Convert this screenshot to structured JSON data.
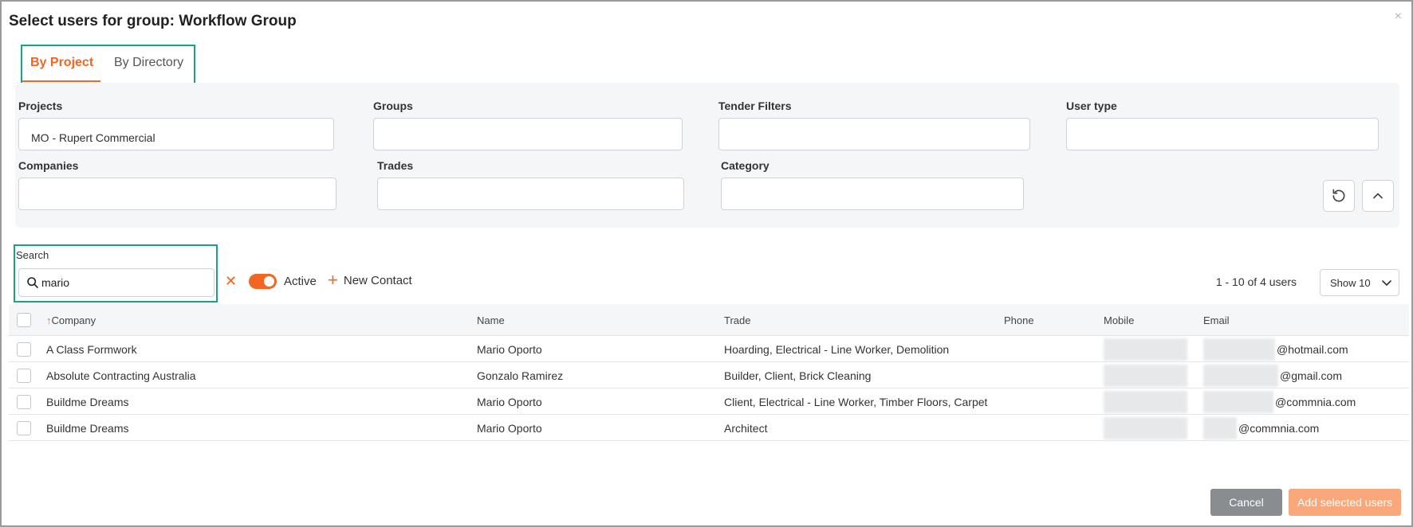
{
  "dialog": {
    "title": "Select users for group: Workflow Group",
    "close_glyph": "×"
  },
  "tabs": [
    {
      "label": "By Project",
      "active": true
    },
    {
      "label": "By Directory",
      "active": false
    }
  ],
  "filters": {
    "projects": {
      "label": "Projects",
      "value": "MO - Rupert Commercial"
    },
    "groups": {
      "label": "Groups",
      "value": ""
    },
    "tender_filters": {
      "label": "Tender Filters",
      "value": ""
    },
    "user_type": {
      "label": "User type",
      "value": ""
    },
    "companies": {
      "label": "Companies",
      "value": ""
    },
    "trades": {
      "label": "Trades",
      "value": ""
    },
    "category": {
      "label": "Category",
      "value": ""
    },
    "reset_icon": "refresh-icon",
    "collapse_icon": "chevron-up-icon"
  },
  "search": {
    "label": "Search",
    "value": "mario",
    "clear_glyph": "✕"
  },
  "active_toggle": {
    "label": "Active",
    "on": true
  },
  "new_contact": {
    "label": "New Contact"
  },
  "pagination": {
    "count_text": "1 - 10 of 4 users",
    "show_label": "Show 10"
  },
  "table": {
    "columns": {
      "company_arrow": "↑",
      "company": "Company",
      "name": "Name",
      "trade": "Trade",
      "phone": "Phone",
      "mobile": "Mobile",
      "email": "Email"
    },
    "rows": [
      {
        "company": "A Class Formwork",
        "name": "Mario Oporto",
        "trade": "Hoarding, Electrical - Line Worker, Demolition",
        "phone": "",
        "email_visible": "@hotmail.com"
      },
      {
        "company": "Absolute Contracting Australia",
        "name": "Gonzalo Ramirez",
        "trade": "Builder, Client, Brick Cleaning",
        "phone": "",
        "email_visible": "@gmail.com"
      },
      {
        "company": "Buildme Dreams",
        "name": "Mario Oporto",
        "trade": "Client, Electrical - Line Worker, Timber Floors, Carpet",
        "phone": "",
        "email_visible": "@commnia.com"
      },
      {
        "company": "Buildme Dreams",
        "name": "Mario Oporto",
        "trade": "Architect",
        "phone": "",
        "email_visible": "@commnia.com"
      }
    ]
  },
  "footer": {
    "cancel_label": "Cancel",
    "add_label": "Add selected users"
  },
  "colors": {
    "accent": "#f26522",
    "highlight": "#13a386",
    "cancel_bg": "#8a8d90",
    "add_bg": "#f9a77b"
  }
}
